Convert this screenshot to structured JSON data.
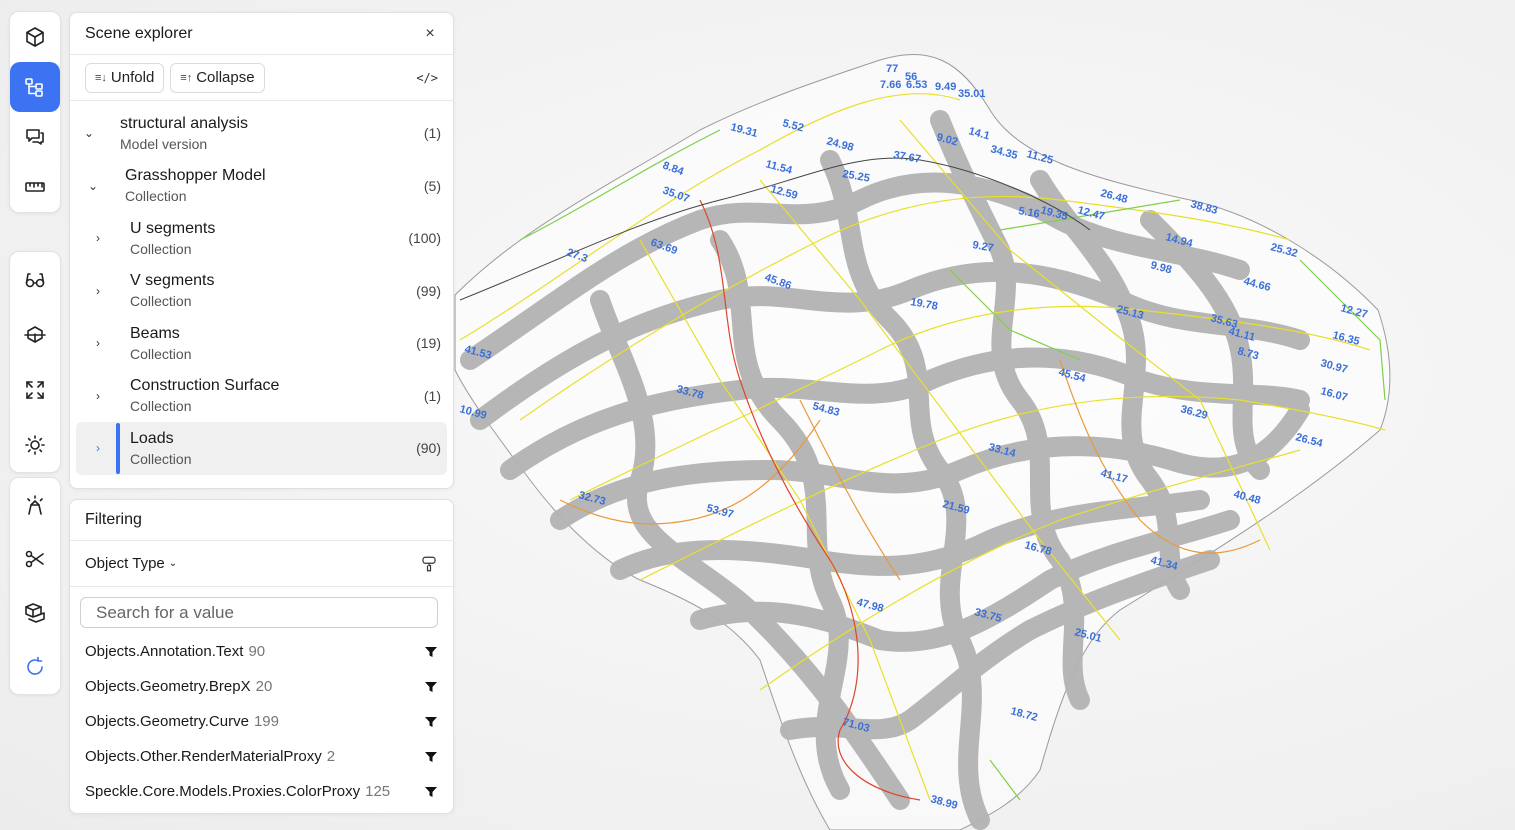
{
  "rail": {
    "group1": [
      {
        "name": "model-cube-icon",
        "active": false
      },
      {
        "name": "scene-tree-icon",
        "active": true
      },
      {
        "name": "comments-icon",
        "active": false
      },
      {
        "name": "measure-icon",
        "active": false
      }
    ],
    "group2": [
      {
        "name": "view-glasses-icon"
      },
      {
        "name": "views-icon"
      },
      {
        "name": "zoom-extents-icon"
      },
      {
        "name": "lighting-sun-icon"
      }
    ],
    "group3": [
      {
        "name": "explode-icon"
      },
      {
        "name": "section-scissors-icon"
      },
      {
        "name": "layers-icon"
      },
      {
        "name": "refresh-icon",
        "accent": true
      }
    ]
  },
  "scene": {
    "title": "Scene explorer",
    "close": "×",
    "unfold": "Unfold",
    "collapse": "Collapse",
    "code": "</>",
    "items": [
      {
        "name": "structural analysis",
        "sub": "Model version",
        "count": "(1)",
        "chev": "⌄",
        "indent": 0
      },
      {
        "name": "Grasshopper Model",
        "sub": "Collection",
        "count": "(5)",
        "chev": "⌄",
        "indent": 1
      },
      {
        "name": "U segments",
        "sub": "Collection",
        "count": "(100)",
        "chev": "›",
        "indent": 2
      },
      {
        "name": "V segments",
        "sub": "Collection",
        "count": "(99)",
        "chev": "›",
        "indent": 2
      },
      {
        "name": "Beams",
        "sub": "Collection",
        "count": "(19)",
        "chev": "›",
        "indent": 2
      },
      {
        "name": "Construction Surface",
        "sub": "Collection",
        "count": "(1)",
        "chev": "›",
        "indent": 2
      },
      {
        "name": "Loads",
        "sub": "Collection",
        "count": "(90)",
        "chev": "›",
        "indent": 2,
        "selected": true
      }
    ]
  },
  "filtering": {
    "title": "Filtering",
    "select": "Object Type",
    "search_placeholder": "Search for a value",
    "facets": [
      {
        "label": "Objects.Annotation.Text",
        "count": "90"
      },
      {
        "label": "Objects.Geometry.BrepX",
        "count": "20"
      },
      {
        "label": "Objects.Geometry.Curve",
        "count": "199"
      },
      {
        "label": "Objects.Other.RenderMaterialProxy",
        "count": "2"
      },
      {
        "label": "Speckle.Core.Models.Proxies.ColorProxy",
        "count": "125"
      }
    ]
  },
  "annotations": [
    "77",
    "56",
    "7.66",
    "6.53",
    "9.49",
    "35.01",
    "19.31",
    "5.52",
    "24.98",
    "9.02",
    "14.1",
    "34.35",
    "11.25",
    "11.54",
    "12.59",
    "37.67",
    "25.25",
    "8.84",
    "35.07",
    "27.3",
    "63.69",
    "45.86",
    "19.78",
    "9.27",
    "5.16",
    "19.35",
    "12.47",
    "26.48",
    "38.83",
    "14.94",
    "9.98",
    "25.32",
    "44.66",
    "25.13",
    "35.63",
    "41.11",
    "8.73",
    "12.27",
    "16.35",
    "30.97",
    "16.07",
    "26.54",
    "45.54",
    "36.29",
    "33.78",
    "54.83",
    "33.14",
    "41.17",
    "40.48",
    "32.73",
    "53.97",
    "21.59",
    "16.78",
    "41.34",
    "47.98",
    "33.75",
    "25.01",
    "18.72",
    "71.03",
    "38.99",
    "41.53",
    "10.99"
  ],
  "colors": {
    "accent": "#3b73f2",
    "annotation": "#3b6fd8",
    "beam": "#b3b3b3",
    "yellow_curve": "#e8e02a",
    "green_curve": "#7ed04a",
    "orange_curve": "#e89a3a",
    "red_curve": "#e0442a"
  }
}
